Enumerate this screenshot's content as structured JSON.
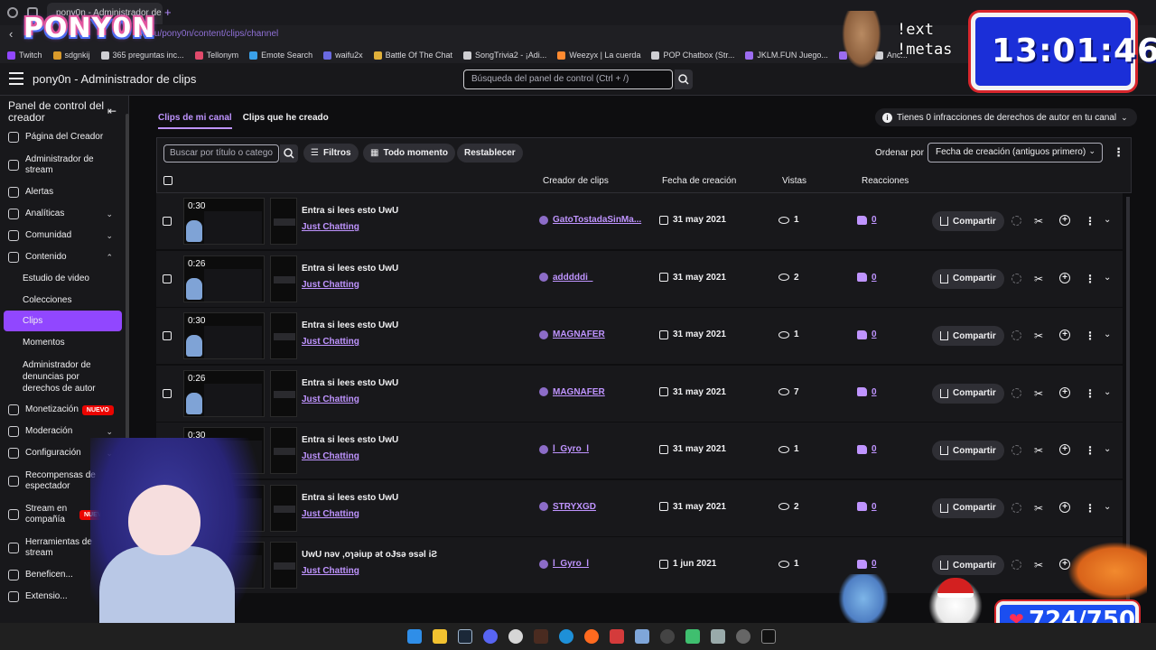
{
  "browser": {
    "active_tab": "pony0n - Administrador de",
    "url_host": "h.tv",
    "url_path": "/u/pony0n/content/clips/channel",
    "bookmarks": [
      {
        "label": "Twitch",
        "color": "#9147ff"
      },
      {
        "label": "sdgnkij",
        "color": "#d99a2b"
      },
      {
        "label": "365 preguntas inc...",
        "color": "#cfcfd3"
      },
      {
        "label": "Tellonym",
        "color": "#e04a6b"
      },
      {
        "label": "Emote Search",
        "color": "#3aa0e8"
      },
      {
        "label": "waifu2x",
        "color": "#6a6ae0"
      },
      {
        "label": "Battle Of The Chat",
        "color": "#e0b03a"
      },
      {
        "label": "SongTrivia2 - ¡Adi...",
        "color": "#cfcfd3"
      },
      {
        "label": "Weezyx | La cuerda",
        "color": "#ff8a30"
      },
      {
        "label": "POP Chatbox (Str...",
        "color": "#cfcfd3"
      },
      {
        "label": "JKLM.FUN Juego...",
        "color": "#9c6cf0"
      },
      {
        "label": "M...",
        "color": "#9c6cf0"
      },
      {
        "label": "Anc...",
        "color": "#cfcfd3"
      }
    ]
  },
  "overlay": {
    "logo": "PONY0N",
    "commands": [
      "!ext",
      "!metas"
    ],
    "clock": "13:01:46",
    "counter": "724/750"
  },
  "header": {
    "title": "pony0n - Administrador de clips",
    "search_placeholder": "Búsqueda del panel de control (Ctrl + /)"
  },
  "sidebar": {
    "title": "Panel de control del creador",
    "items": [
      {
        "label": "Página del Creador"
      },
      {
        "label": "Administrador de stream"
      },
      {
        "label": "Alertas"
      },
      {
        "label": "Analíticas"
      },
      {
        "label": "Comunidad"
      },
      {
        "label": "Contenido"
      },
      {
        "label": "Estudio de video"
      },
      {
        "label": "Colecciones"
      },
      {
        "label": "Clips"
      },
      {
        "label": "Momentos"
      },
      {
        "label": "Administrador de denuncias por derechos de autor"
      },
      {
        "label": "Monetización",
        "badge": "NUEVO"
      },
      {
        "label": "Moderación"
      },
      {
        "label": "Configuración"
      },
      {
        "label": "Recompensas de espectador"
      },
      {
        "label": "Stream en compañía",
        "badge": "NUEVO"
      },
      {
        "label": "Herramientas de stream"
      },
      {
        "label": "Beneficen..."
      },
      {
        "label": "Extensio..."
      }
    ]
  },
  "main": {
    "tabs": [
      {
        "label": "Clips de mi canal",
        "active": true
      },
      {
        "label": "Clips que he creado",
        "active": false
      }
    ],
    "copyright_notice": "Tienes 0 infracciones de derechos de autor en tu canal",
    "filter_placeholder": "Buscar por título o catego",
    "filters_label": "Filtros",
    "time_label": "Todo momento",
    "reset_label": "Restablecer",
    "sort_label": "Ordenar por",
    "sort_value": "Fecha de creación (antiguos primero)",
    "columns": [
      "Creador de clips",
      "Fecha de creación",
      "Vistas",
      "Reacciones"
    ],
    "share_label": "Compartir",
    "clips": [
      {
        "duration": "0:30",
        "title": "Entra si lees esto UwU",
        "category": "Just Chatting",
        "creator": "GatoTostadaSinMa...",
        "date": "31 may 2021",
        "views": "1",
        "reactions": "0"
      },
      {
        "duration": "0:26",
        "title": "Entra si lees esto UwU",
        "category": "Just Chatting",
        "creator": "adddddi_",
        "date": "31 may 2021",
        "views": "2",
        "reactions": "0"
      },
      {
        "duration": "0:30",
        "title": "Entra si lees esto UwU",
        "category": "Just Chatting",
        "creator": "MAGNAFER",
        "date": "31 may 2021",
        "views": "1",
        "reactions": "0"
      },
      {
        "duration": "0:26",
        "title": "Entra si lees esto UwU",
        "category": "Just Chatting",
        "creator": "MAGNAFER",
        "date": "31 may 2021",
        "views": "7",
        "reactions": "0"
      },
      {
        "duration": "0:30",
        "title": "Entra si lees esto UwU",
        "category": "Just Chatting",
        "creator": "l_Gyro_l",
        "date": "31 may 2021",
        "views": "1",
        "reactions": "0"
      },
      {
        "duration": "",
        "title": "Entra si lees esto UwU",
        "category": "Just Chatting",
        "creator": "STRYXGD",
        "date": "31 may 2021",
        "views": "2",
        "reactions": "0"
      },
      {
        "duration": "",
        "title": "UwU nəv ,oɿəiup ət oɈsə ɘsəl iƧ",
        "category": "Just Chatting",
        "creator": "l_Gyro_l",
        "date": "1 jun 2021",
        "views": "1",
        "reactions": "0"
      }
    ]
  }
}
